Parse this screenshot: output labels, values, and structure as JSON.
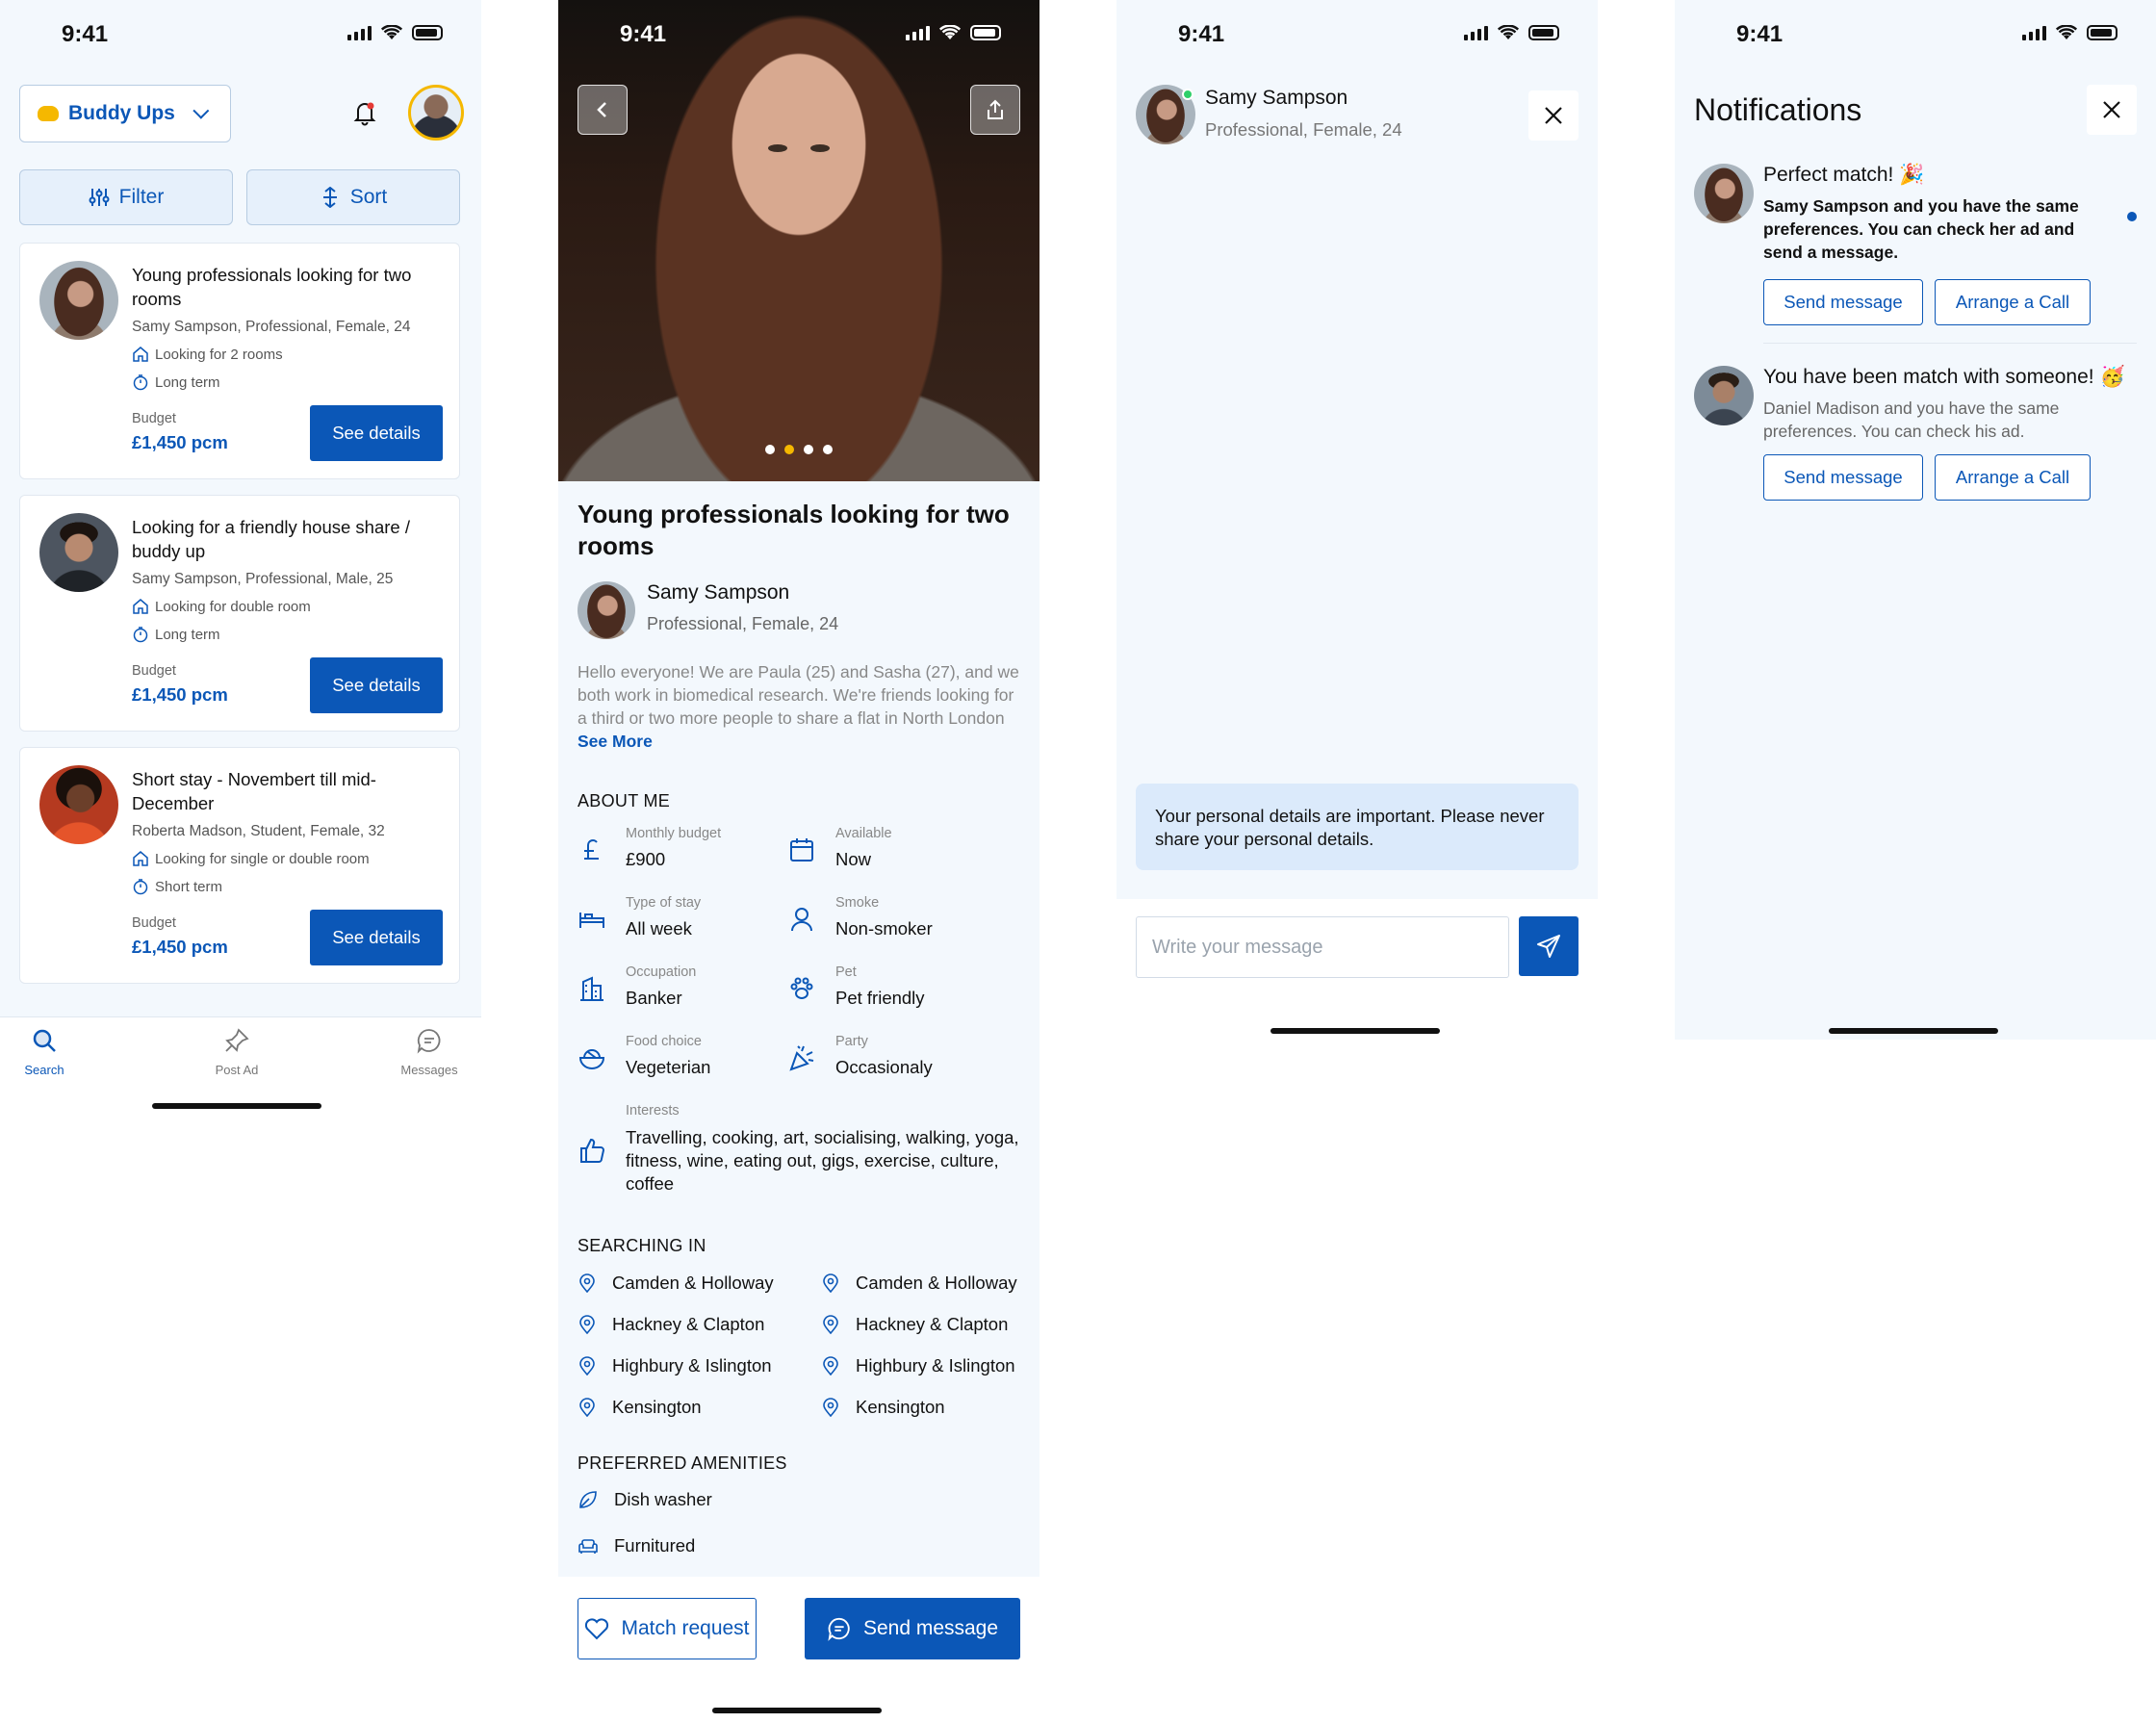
{
  "status_bar": {
    "time": "9:41"
  },
  "screen1": {
    "brand": {
      "label": "Buddy Ups",
      "logo_icon": "emoji-hand-icon"
    },
    "filter_label": "Filter",
    "sort_label": "Sort",
    "listings": [
      {
        "title": "Young professionals looking for two rooms",
        "subtitle": "Samy Sampson, Professional, Female, 24",
        "looking": "Looking for 2 rooms",
        "term": "Long term",
        "budget_label": "Budget",
        "budget": "£1,450 pcm",
        "button": "See details"
      },
      {
        "title": "Looking for a friendly house share / buddy up",
        "subtitle": "Samy Sampson, Professional, Male, 25",
        "looking": "Looking for double room",
        "term": "Long term",
        "budget_label": "Budget",
        "budget": "£1,450 pcm",
        "button": "See details"
      },
      {
        "title": "Short stay - Novembert till mid-December",
        "subtitle": "Roberta Madson, Student, Female, 32",
        "looking": "Looking for single or double room",
        "term": "Short term",
        "budget_label": "Budget",
        "budget": "£1,450 pcm",
        "button": "See details"
      }
    ],
    "tabs": [
      {
        "label": "Search",
        "icon": "search-icon",
        "active": true
      },
      {
        "label": "Post Ad",
        "icon": "pin-icon",
        "active": false
      },
      {
        "label": "Messages",
        "icon": "chat-icon",
        "active": false
      }
    ]
  },
  "screen2": {
    "photo_pages": 4,
    "photo_active_page": 2,
    "title": "Young professionals looking for two rooms",
    "name": "Samy Sampson",
    "meta": "Professional, Female, 24",
    "description": "Hello everyone! We are Paula (25) and Sasha (27), and we both work in biomedical research. We're friends looking for a third or two more people to share a flat in North London",
    "see_more": "See More",
    "about_heading": "ABOUT ME",
    "about": [
      {
        "label": "Monthly budget",
        "value": "£900",
        "icon": "pound-icon"
      },
      {
        "label": "Available",
        "value": "Now",
        "icon": "calendar-icon"
      },
      {
        "label": "Type of stay",
        "value": "All week",
        "icon": "bed-icon"
      },
      {
        "label": "Smoke",
        "value": "Non-smoker",
        "icon": "person-icon"
      },
      {
        "label": "Occupation",
        "value": "Banker",
        "icon": "building-icon"
      },
      {
        "label": "Pet",
        "value": "Pet friendly",
        "icon": "paw-icon"
      },
      {
        "label": "Food choice",
        "value": "Vegeterian",
        "icon": "bowl-icon"
      },
      {
        "label": "Party",
        "value": "Occasionaly",
        "icon": "party-icon"
      }
    ],
    "interests_label": "Interests",
    "interests_value": "Travelling, cooking, art, socialising, walking, yoga, fitness, wine, eating out, gigs, exercise, culture, coffee",
    "searching_heading": "SEARCHING IN",
    "searching_in": [
      "Camden & Holloway",
      "Camden & Holloway",
      "Hackney & Clapton",
      "Hackney & Clapton",
      "Highbury & Islington",
      "Highbury & Islington",
      "Kensington",
      "Kensington"
    ],
    "amenities_heading": "PREFERRED AMENITIES",
    "amenities": [
      {
        "label": "Dish washer",
        "icon": "leaf-icon"
      },
      {
        "label": "Furnitured",
        "icon": "sofa-icon"
      }
    ],
    "match_button": "Match request",
    "send_button": "Send message"
  },
  "screen3": {
    "name": "Samy Sampson",
    "meta": "Professional, Female, 24",
    "notice": "Your personal details are important. Please never share your personal details.",
    "input_placeholder": "Write your message",
    "input_value": ""
  },
  "screen4": {
    "title": "Notifications",
    "items": [
      {
        "heading": "Perfect match! 🎉",
        "body": "Samy Sampson and you have the same preferences. You can check her ad and send a message.",
        "unread": true,
        "btn1": "Send message",
        "btn2": "Arrange a Call"
      },
      {
        "heading": "You have been match with someone! 🥳",
        "body": "Daniel Madison and you have the same preferences. You can check his ad.",
        "unread": false,
        "btn1": "Send message",
        "btn2": "Arrange a Call"
      }
    ]
  },
  "colors": {
    "primary": "#0b57b7",
    "background": "#f3f8fd",
    "accent": "#f5b800",
    "notice": "#dbeafb"
  }
}
